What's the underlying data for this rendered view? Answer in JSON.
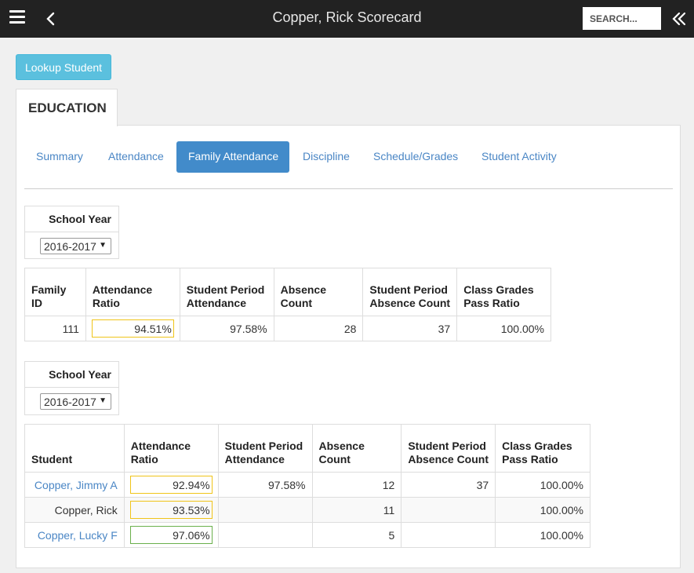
{
  "header": {
    "title": "Copper, Rick Scorecard",
    "search_placeholder": "SEARCH..."
  },
  "lookup_label": "Lookup Student",
  "section_tab": "EDUCATION",
  "tabs": [
    "Summary",
    "Attendance",
    "Family Attendance",
    "Discipline",
    "Schedule/Grades",
    "Student Activity"
  ],
  "active_tab": "Family Attendance",
  "family_section": {
    "school_year_label": "School Year",
    "school_year_value": "2016-2017",
    "columns": [
      "Family ID",
      "Attendance Ratio",
      "Student Period Attendance",
      "Absence Count",
      "Student Period Absence Count",
      "Class Grades Pass Ratio"
    ],
    "rows": [
      {
        "family_id": "111",
        "attendance_ratio": "94.51%",
        "student_period_attendance": "97.58%",
        "absence_count": "28",
        "student_period_absence_count": "37",
        "class_grades_pass_ratio": "100.00%"
      }
    ]
  },
  "student_section": {
    "school_year_label": "School Year",
    "school_year_value": "2016-2017",
    "columns": [
      "Student",
      "Attendance Ratio",
      "Student Period Attendance",
      "Absence Count",
      "Student Period Absence Count",
      "Class Grades Pass Ratio"
    ],
    "rows": [
      {
        "student": "Copper, Jimmy A",
        "attendance_ratio": "92.94%",
        "student_period_attendance": "97.58%",
        "absence_count": "12",
        "student_period_absence_count": "37",
        "class_grades_pass_ratio": "100.00%"
      },
      {
        "student": "Copper, Rick",
        "attendance_ratio": "93.53%",
        "student_period_attendance": "",
        "absence_count": "11",
        "student_period_absence_count": "",
        "class_grades_pass_ratio": "100.00%"
      },
      {
        "student": "Copper, Lucky F",
        "attendance_ratio": "97.06%",
        "student_period_attendance": "",
        "absence_count": "5",
        "student_period_absence_count": "",
        "class_grades_pass_ratio": "100.00%"
      }
    ]
  },
  "colors": {
    "topbar": "#222222",
    "accent": "#428bca",
    "link": "#4a86c5",
    "lookup_button": "#5bc0de",
    "ratio_border_warning": "#f0c419",
    "ratio_border_good": "#6ab04c"
  },
  "icons": {
    "menu": "hamburger-icon",
    "back": "chevron-left-icon",
    "collapse": "double-chevron-left-icon",
    "select": "caret-down-icon"
  }
}
